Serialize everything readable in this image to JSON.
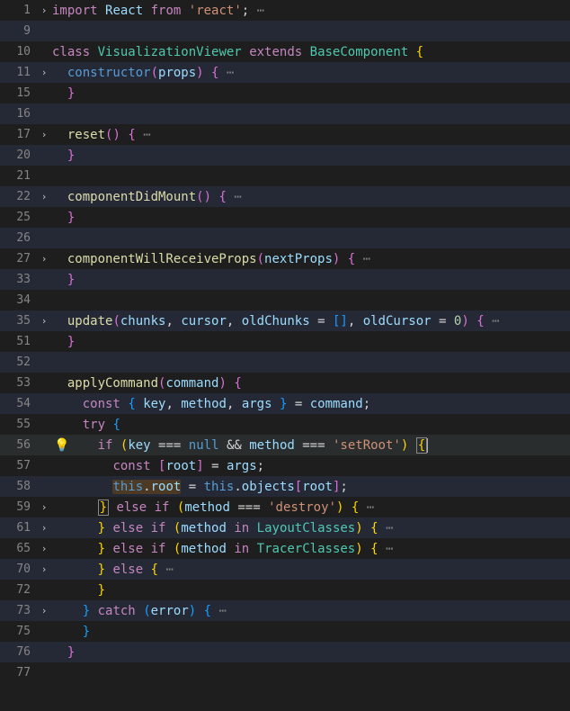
{
  "lines": [
    {
      "num": "1",
      "fold": "›",
      "alt": false
    },
    {
      "num": "9",
      "fold": "",
      "alt": true
    },
    {
      "num": "10",
      "fold": "",
      "alt": false
    },
    {
      "num": "11",
      "fold": "›",
      "alt": true
    },
    {
      "num": "15",
      "fold": "",
      "alt": false
    },
    {
      "num": "16",
      "fold": "",
      "alt": true
    },
    {
      "num": "17",
      "fold": "›",
      "alt": false
    },
    {
      "num": "20",
      "fold": "",
      "alt": true
    },
    {
      "num": "21",
      "fold": "",
      "alt": false
    },
    {
      "num": "22",
      "fold": "›",
      "alt": true
    },
    {
      "num": "25",
      "fold": "",
      "alt": false
    },
    {
      "num": "26",
      "fold": "",
      "alt": true
    },
    {
      "num": "27",
      "fold": "›",
      "alt": false
    },
    {
      "num": "33",
      "fold": "",
      "alt": true
    },
    {
      "num": "34",
      "fold": "",
      "alt": false
    },
    {
      "num": "35",
      "fold": "›",
      "alt": true
    },
    {
      "num": "51",
      "fold": "",
      "alt": false
    },
    {
      "num": "52",
      "fold": "",
      "alt": true
    },
    {
      "num": "53",
      "fold": "",
      "alt": false
    },
    {
      "num": "54",
      "fold": "",
      "alt": true
    },
    {
      "num": "55",
      "fold": "",
      "alt": false
    },
    {
      "num": "56",
      "fold": "",
      "alt": true,
      "bulb": true,
      "hl": true
    },
    {
      "num": "57",
      "fold": "",
      "alt": false
    },
    {
      "num": "58",
      "fold": "",
      "alt": true
    },
    {
      "num": "59",
      "fold": "›",
      "alt": false
    },
    {
      "num": "61",
      "fold": "›",
      "alt": true
    },
    {
      "num": "65",
      "fold": "›",
      "alt": false
    },
    {
      "num": "70",
      "fold": "›",
      "alt": true
    },
    {
      "num": "72",
      "fold": "",
      "alt": false
    },
    {
      "num": "73",
      "fold": "›",
      "alt": true
    },
    {
      "num": "75",
      "fold": "",
      "alt": false
    },
    {
      "num": "76",
      "fold": "",
      "alt": true
    },
    {
      "num": "77",
      "fold": "",
      "alt": false
    }
  ],
  "tokens": {
    "import": "import",
    "react": "React",
    "from": "from",
    "str_react": "'react'",
    "class": "class",
    "className": "VisualizationViewer",
    "extends": "extends",
    "baseComp": "BaseComponent",
    "constructor": "constructor",
    "props": "props",
    "reset": "reset",
    "cdm": "componentDidMount",
    "cwrp": "componentWillReceiveProps",
    "nextProps": "nextProps",
    "update": "update",
    "chunks": "chunks",
    "cursor": "cursor",
    "oldChunks": "oldChunks",
    "oldCursor": "oldCursor",
    "zero": "0",
    "applyCommand": "applyCommand",
    "command": "command",
    "const": "const",
    "key": "key",
    "method": "method",
    "args": "args",
    "try": "try",
    "if": "if",
    "eqeqeq": "===",
    "null": "null",
    "ampamp": "&&",
    "setRoot": "'setRoot'",
    "root": "root",
    "this": "this",
    "objects": "objects",
    "else": "else",
    "destroy": "'destroy'",
    "in": "in",
    "layoutClasses": "LayoutClasses",
    "tracerClasses": "TracerClasses",
    "catch": "catch",
    "error": "error",
    "dots": "⋯",
    "semi": ";",
    "comma": ",",
    "eq": "=",
    "dot": ".",
    "lb": "{",
    "rb": "}",
    "lp": "(",
    "rp": ")",
    "ls": "[",
    "rs": "]"
  }
}
